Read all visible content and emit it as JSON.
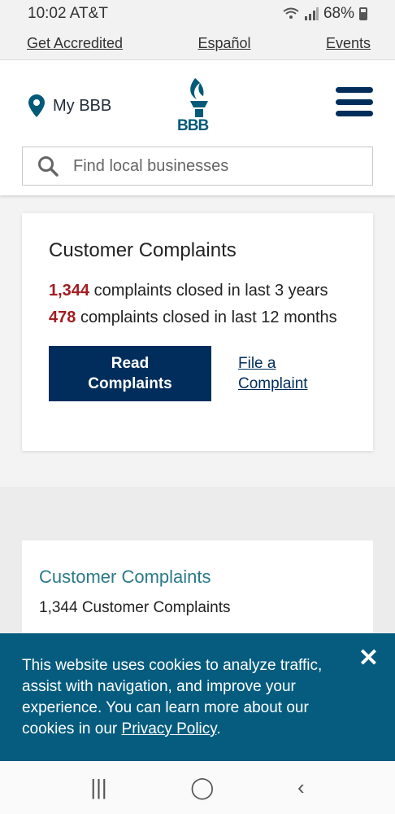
{
  "status": {
    "time": "10:02 AT&T",
    "battery": "68%"
  },
  "top_links": [
    "Get Accredited",
    "Español",
    "Events"
  ],
  "header": {
    "my_bbb": "My BBB",
    "logo_text": "BBB",
    "search_placeholder": "Find local businesses"
  },
  "complaints_card": {
    "title": "Customer Complaints",
    "stat1_num": "1,344",
    "stat1_text": "complaints closed in last 3 years",
    "stat2_num": "478",
    "stat2_text": "complaints closed in last 12 months",
    "read_button": "Read Complaints",
    "file_link": "File a Complaint"
  },
  "second_card": {
    "title": "Customer Complaints",
    "subtitle": "1,344 Customer Complaints"
  },
  "cookie": {
    "text": "This website uses cookies to analyze traffic, assist with navigation, and improve your experience. You can learn more about our cookies in our",
    "link": "Privacy Policy",
    "suffix": ".",
    "close": "✕"
  },
  "nav": {
    "recents": "|||",
    "home": "◯",
    "back": "‹"
  }
}
